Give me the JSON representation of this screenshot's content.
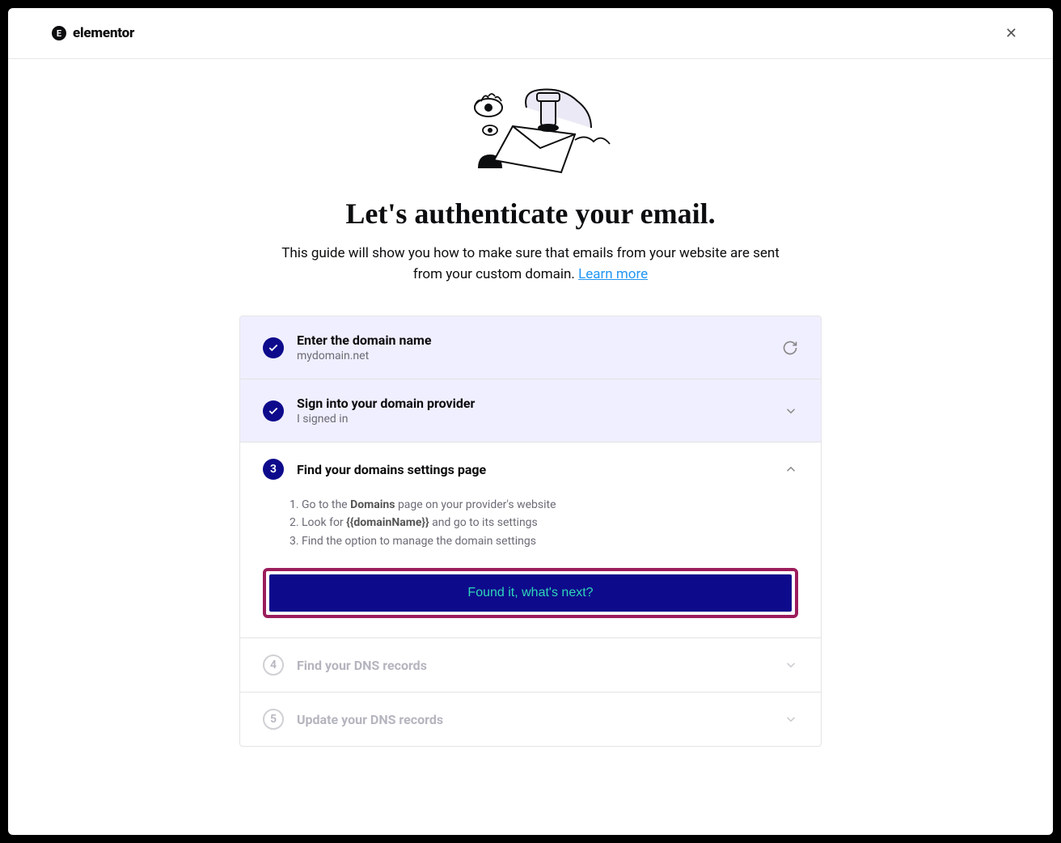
{
  "brand": {
    "name": "elementor",
    "icon_letter": "E"
  },
  "hero": {
    "title": "Let's authenticate your email.",
    "subtitle_part1": "This guide will show you how to make sure that emails from your website are sent from your custom domain. ",
    "learn_more": "Learn more"
  },
  "steps": [
    {
      "title": "Enter the domain name",
      "subtitle": "mydomain.net",
      "status": "completed",
      "action_icon": "refresh"
    },
    {
      "title": "Sign into your domain provider",
      "subtitle": "I signed in",
      "status": "completed",
      "action_icon": "chevron-down"
    },
    {
      "number": "3",
      "title": "Find your domains settings page",
      "status": "active",
      "action_icon": "chevron-up",
      "instructions": {
        "line1_pre": "Go to the ",
        "line1_bold": "Domains",
        "line1_post": " page on your provider's website",
        "line2_pre": "Look for ",
        "line2_bold": "{{domainName}}",
        "line2_post": " and go to its settings",
        "line3": "Find the option to manage the domain settings"
      },
      "cta": "Found it, what's next?"
    },
    {
      "number": "4",
      "title": "Find your DNS records",
      "status": "pending",
      "action_icon": "chevron-down"
    },
    {
      "number": "5",
      "title": "Update your DNS records",
      "status": "pending",
      "action_icon": "chevron-down"
    }
  ]
}
